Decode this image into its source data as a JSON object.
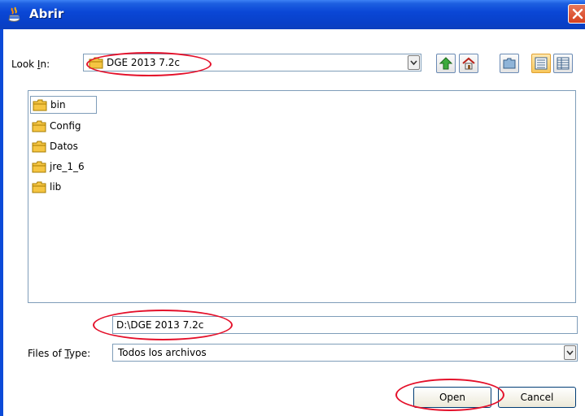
{
  "window": {
    "title": "Abrir"
  },
  "lookin": {
    "label_pre": "Look ",
    "label_mnemonic": "I",
    "label_post": "n:",
    "value": "DGE 2013 7.2c"
  },
  "toolbar": {
    "icons": [
      "up-folder-icon",
      "home-icon",
      "new-folder-icon",
      "list-view-icon",
      "details-view-icon"
    ]
  },
  "files": [
    {
      "name": "bin",
      "selected": true
    },
    {
      "name": "Config",
      "selected": false
    },
    {
      "name": "Datos",
      "selected": false
    },
    {
      "name": "jre_1_6",
      "selected": false
    },
    {
      "name": "lib",
      "selected": false
    }
  ],
  "filename": {
    "value": "D:\\DGE 2013 7.2c"
  },
  "filetype": {
    "label_pre": "Files of ",
    "label_mnemonic": "T",
    "label_post": "ype:",
    "value": "Todos los archivos"
  },
  "buttons": {
    "open": "Open",
    "cancel": "Cancel"
  },
  "colors": {
    "titlebar": "#0840c8",
    "annotation": "#e4102a",
    "folder": "#f5c542"
  }
}
